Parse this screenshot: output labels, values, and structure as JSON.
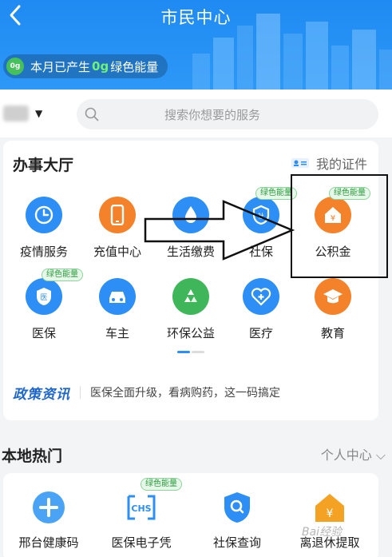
{
  "header": {
    "title": "市民中心",
    "back_icon": "chevron-left-icon",
    "energy": {
      "prefix": "本月已产生",
      "value": "0g",
      "suffix": "绿色能量",
      "icon_text": "0g"
    }
  },
  "search": {
    "placeholder": "搜索你想要的服务"
  },
  "hall": {
    "title": "办事大厅",
    "my_cert": "我的证件",
    "badge_text": "绿色能量",
    "row1": [
      "疫情服务",
      "充值中心",
      "生活缴费",
      "社保",
      "公积金"
    ],
    "row2": [
      "医保",
      "车主",
      "环保公益",
      "医疗",
      "教育"
    ],
    "policy_logo": "政策资讯",
    "policy_text": "医保全面升级，看病购药，这一码搞定"
  },
  "hot": {
    "title": "本地热门",
    "link": "个人中心",
    "items": [
      "邢台健康码",
      "医保电子凭",
      "社保查询",
      "离退休提取"
    ],
    "badge_text": "绿色能量"
  },
  "colors": {
    "primary": "#2d8ef5",
    "orange": "#f3822b",
    "green": "#3fb65a",
    "header": "#1f8af2"
  },
  "watermark": "Bai经验"
}
